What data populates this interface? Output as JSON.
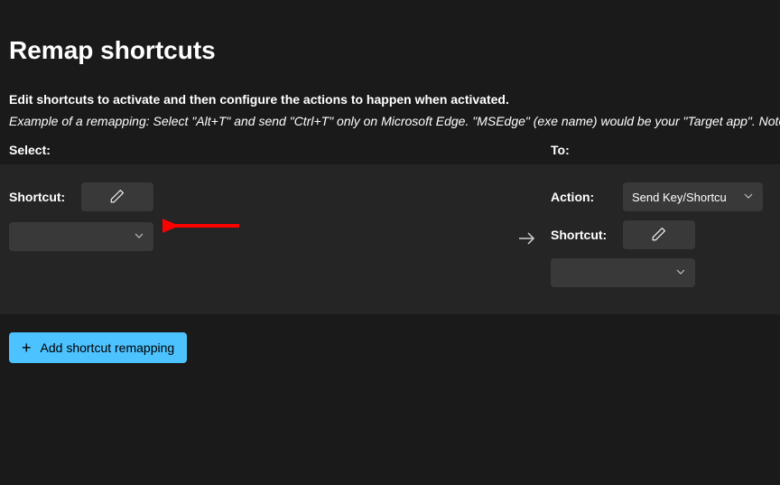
{
  "page": {
    "title": "Remap shortcuts",
    "description": "Edit shortcuts to activate and then configure the actions to happen when activated.",
    "example": "Example of a remapping: Select \"Alt+T\" and send \"Ctrl+T\" only on Microsoft Edge. \"MSEdge\" (exe name) would be your \"Target app\". Note: if y"
  },
  "columns": {
    "select": "Select:",
    "to": "To:"
  },
  "fields": {
    "shortcut": "Shortcut:",
    "action": "Action:",
    "shortcut_to": "Shortcut:"
  },
  "action_dropdown": {
    "selected": "Send Key/Shortcu"
  },
  "add_button": {
    "label": "Add shortcut remapping"
  }
}
